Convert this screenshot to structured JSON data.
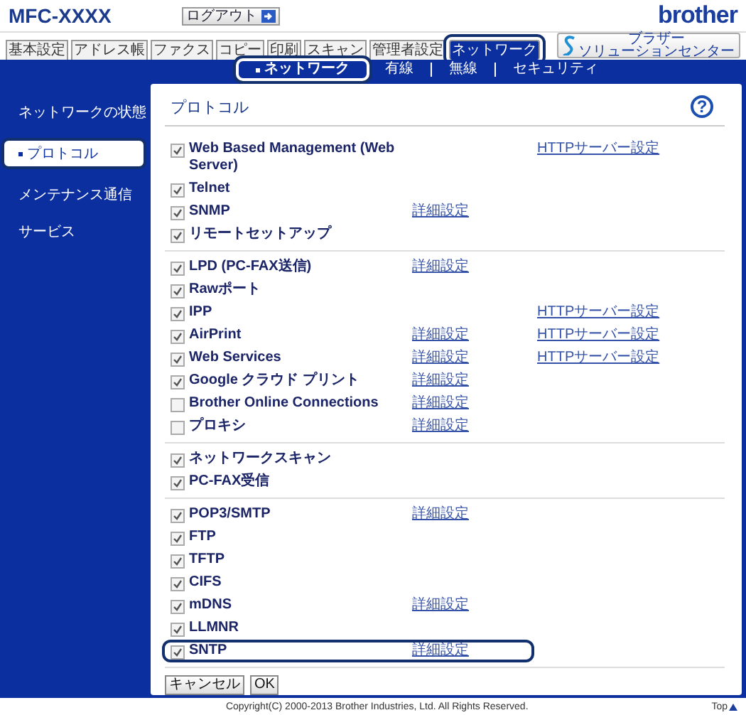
{
  "header": {
    "title": "MFC-XXXX",
    "logout": "ログアウト",
    "logo": "brother",
    "solution_center": [
      "ブラザー",
      "ソリューションセンター"
    ]
  },
  "tabs": [
    {
      "label": "基本設定",
      "selected": false,
      "highlighted": false
    },
    {
      "label": "アドレス帳",
      "selected": false,
      "highlighted": false
    },
    {
      "label": "ファクス",
      "selected": false,
      "highlighted": false
    },
    {
      "label": "コピー",
      "selected": false,
      "highlighted": false
    },
    {
      "label": "印刷",
      "selected": false,
      "highlighted": false
    },
    {
      "label": "スキャン",
      "selected": false,
      "highlighted": false
    },
    {
      "label": "管理者設定",
      "selected": false,
      "highlighted": false
    },
    {
      "label": "ネットワーク",
      "selected": true,
      "highlighted": true
    }
  ],
  "subtabs": [
    {
      "label": "ネットワーク",
      "selected": true,
      "highlighted": true
    },
    {
      "label": "有線",
      "selected": false,
      "highlighted": false
    },
    {
      "label": "無線",
      "selected": false,
      "highlighted": false
    },
    {
      "label": "セキュリティ",
      "selected": false,
      "highlighted": false
    }
  ],
  "sidebar": {
    "items": [
      {
        "label": "ネットワークの状態",
        "selected": false,
        "highlighted": false
      },
      {
        "label": "プロトコル",
        "selected": true,
        "highlighted": true
      },
      {
        "label": "メンテナンス通信",
        "selected": false,
        "highlighted": false
      },
      {
        "label": "サービス",
        "selected": false,
        "highlighted": false
      }
    ]
  },
  "panel": {
    "title": "プロトコル",
    "help": "?",
    "groups": [
      [
        {
          "label": "Web Based Management (Web Server)",
          "checked": true,
          "highlighted": false,
          "http": "HTTPサーバー設定"
        },
        {
          "label": "Telnet",
          "checked": true,
          "highlighted": false
        },
        {
          "label": "SNMP",
          "checked": true,
          "highlighted": false,
          "detail": "詳細設定"
        },
        {
          "label": "リモートセットアップ",
          "checked": true,
          "highlighted": false
        }
      ],
      [
        {
          "label": "LPD (PC-FAX送信)",
          "checked": true,
          "highlighted": false,
          "detail": "詳細設定"
        },
        {
          "label": "Rawポート",
          "checked": true,
          "highlighted": false
        },
        {
          "label": "IPP",
          "checked": true,
          "highlighted": false,
          "http": "HTTPサーバー設定"
        },
        {
          "label": "AirPrint",
          "checked": true,
          "highlighted": false,
          "detail": "詳細設定",
          "http": "HTTPサーバー設定"
        },
        {
          "label": "Web Services",
          "checked": true,
          "highlighted": false,
          "detail": "詳細設定",
          "http": "HTTPサーバー設定"
        },
        {
          "label": "Google クラウド プリント",
          "checked": true,
          "highlighted": false,
          "detail": "詳細設定"
        },
        {
          "label": "Brother Online Connections",
          "checked": false,
          "highlighted": false,
          "detail": "詳細設定"
        },
        {
          "label": "プロキシ",
          "checked": false,
          "highlighted": false,
          "detail": "詳細設定"
        }
      ],
      [
        {
          "label": "ネットワークスキャン",
          "checked": true,
          "highlighted": false
        },
        {
          "label": "PC-FAX受信",
          "checked": true,
          "highlighted": false
        }
      ],
      [
        {
          "label": "POP3/SMTP",
          "checked": true,
          "highlighted": false,
          "detail": "詳細設定"
        },
        {
          "label": "FTP",
          "checked": true,
          "highlighted": false
        },
        {
          "label": "TFTP",
          "checked": true,
          "highlighted": false
        },
        {
          "label": "CIFS",
          "checked": true,
          "highlighted": false
        },
        {
          "label": "mDNS",
          "checked": true,
          "highlighted": false,
          "detail": "詳細設定"
        },
        {
          "label": "LLMNR",
          "checked": true,
          "highlighted": false
        },
        {
          "label": "SNTP",
          "checked": true,
          "highlighted": true,
          "detail": "詳細設定"
        }
      ]
    ],
    "buttons": [
      "キャンセル",
      "OK"
    ]
  },
  "footer": {
    "copyright": "Copyright(C) 2000-2013 Brother Industries, Ltd. All Rights Reserved.",
    "top": "Top"
  }
}
